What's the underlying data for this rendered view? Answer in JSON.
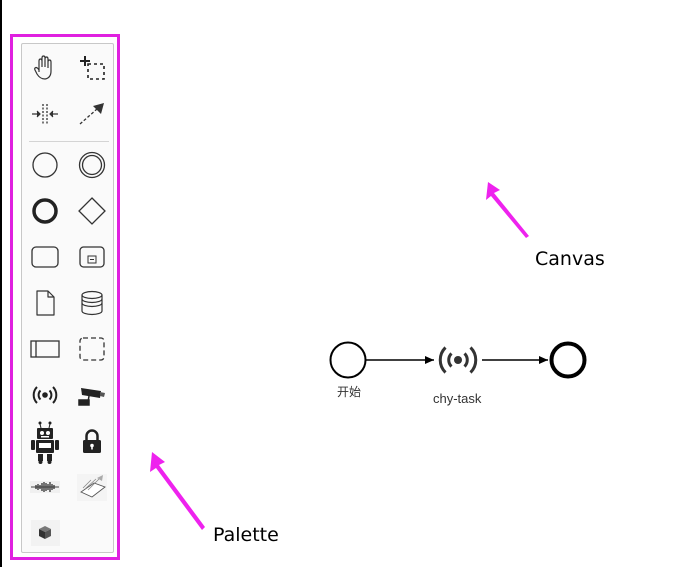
{
  "palette": {
    "label": "Palette",
    "tools": [
      {
        "name": "hand-tool",
        "icon": "hand-icon"
      },
      {
        "name": "lasso-tool",
        "icon": "lasso-select-icon"
      },
      {
        "name": "space-tool",
        "icon": "space-tool-icon"
      },
      {
        "name": "global-connect-tool",
        "icon": "connect-arrow-icon"
      },
      {
        "name": "create-start-event",
        "icon": "start-event-circle-icon"
      },
      {
        "name": "create-intermediate-event",
        "icon": "intermediate-event-double-circle-icon"
      },
      {
        "name": "create-end-event",
        "icon": "end-event-thick-circle-icon"
      },
      {
        "name": "create-gateway",
        "icon": "gateway-diamond-icon"
      },
      {
        "name": "create-task",
        "icon": "task-rounded-rect-icon"
      },
      {
        "name": "create-subprocess",
        "icon": "subprocess-icon"
      },
      {
        "name": "create-data-object",
        "icon": "data-object-icon"
      },
      {
        "name": "create-data-store",
        "icon": "data-store-icon"
      },
      {
        "name": "create-pool",
        "icon": "pool-participant-icon"
      },
      {
        "name": "create-group",
        "icon": "group-dashed-icon"
      },
      {
        "name": "create-broadcast-task",
        "icon": "broadcast-icon"
      },
      {
        "name": "create-camera-task",
        "icon": "security-camera-icon"
      },
      {
        "name": "create-robot-task",
        "icon": "robot-icon"
      },
      {
        "name": "create-lock-task",
        "icon": "padlock-icon"
      },
      {
        "name": "create-audio-task",
        "icon": "waveform-icon"
      },
      {
        "name": "create-scanner-task",
        "icon": "scanner-icon"
      },
      {
        "name": "create-package-task",
        "icon": "package-box-icon"
      }
    ]
  },
  "canvas": {
    "label": "Canvas",
    "nodes": {
      "start": {
        "label": "开始"
      },
      "task": {
        "label": "chy-task"
      }
    }
  },
  "colors": {
    "highlight": "#e020e0",
    "arrow": "#ee22ee"
  }
}
